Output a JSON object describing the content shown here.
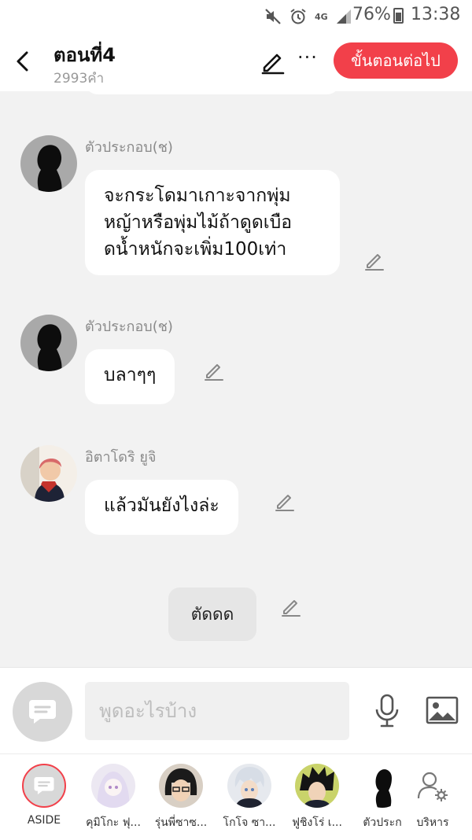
{
  "status_bar": {
    "battery": "76%",
    "time": "13:38",
    "network": "4G",
    "icons": [
      "mute-icon",
      "alarm-icon",
      "signal-icon",
      "battery-icon"
    ]
  },
  "header": {
    "title": "ตอนที่4",
    "word_count": "2993คำ",
    "next_button": "ขั้นตอนต่อไป"
  },
  "messages": [
    {
      "sender": "ตัวประกอบ(ช)",
      "text": "จะกระโดมาเกาะจากพุ่มหญ้าหรือพุ่มไม้ถ้าดูดเบือดน้ำหนักจะเพิ่ม100เท่า",
      "lines": [
        "จะกระโดมาเกาะจากพุ่ม",
        "หญ้าหรือพุ่มไม้ถ้าดูดเบือ",
        "ดน้ำหนักจะเพิ่ม100เท่า"
      ]
    },
    {
      "sender": "ตัวประกอบ(ช)",
      "text": "บลาๆๆ"
    },
    {
      "sender": "อิตาโดริ ยูจิ",
      "text": "แล้วมันยังไงล่ะ"
    }
  ],
  "narration": {
    "text": "ตัดดด"
  },
  "input": {
    "placeholder": "พูดอะไรบ้าง"
  },
  "characters": [
    {
      "label": "ASIDE"
    },
    {
      "label": "คุมิโกะ ฟุ..."
    },
    {
      "label": "รุ่นพี่ซาซ..."
    },
    {
      "label": "โกโจ ซา..."
    },
    {
      "label": "ฟูชิงโร่ เ..."
    },
    {
      "label": "ตัวประก"
    },
    {
      "label": "บริหาร"
    }
  ],
  "colors": {
    "accent": "#f2404a",
    "background": "#f2f2f2"
  }
}
